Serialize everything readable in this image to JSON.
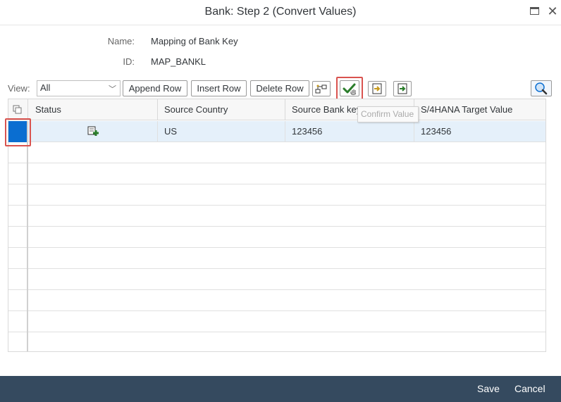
{
  "window": {
    "title": "Bank: Step 2 (Convert Values)",
    "maximize_icon": "maximize-icon",
    "close_glyph": "✕"
  },
  "fields": {
    "name_label": "Name:",
    "name_value": "Mapping of Bank Key",
    "id_label": "ID:",
    "id_value": "MAP_BANKL"
  },
  "toolbar": {
    "view_label": "View:",
    "view_value": "All",
    "append_row": "Append Row",
    "insert_row": "Insert Row",
    "delete_row": "Delete Row",
    "icons": [
      "hierarchy-icon",
      "confirm-checkmark-icon",
      "import-icon",
      "export-icon",
      "search-icon"
    ]
  },
  "tooltip": "Confirm Value",
  "table": {
    "columns": [
      "Status",
      "Source Country",
      "Source Bank key",
      "S/4HANA Target Value"
    ],
    "rows": [
      {
        "status_icon": "status-add-icon",
        "source_country": "US",
        "source_bank_key": "123456",
        "target_value": "123456"
      }
    ],
    "empty_rows": 10
  },
  "footer": {
    "save": "Save",
    "cancel": "Cancel"
  },
  "colors": {
    "selected_row": "#e5f0fa",
    "row_selector_active": "#0a6ed1",
    "highlight_box": "#d9534f",
    "footer_bg": "#354a5f",
    "confirm_check": "#2b7d2b"
  }
}
